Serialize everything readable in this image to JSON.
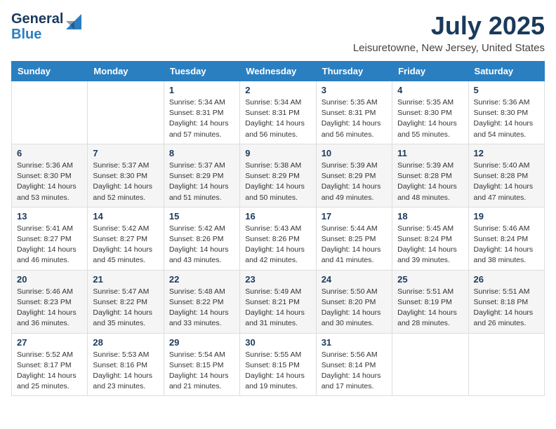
{
  "header": {
    "logo_line1": "General",
    "logo_line2": "Blue",
    "month_year": "July 2025",
    "location": "Leisuretowne, New Jersey, United States"
  },
  "days_of_week": [
    "Sunday",
    "Monday",
    "Tuesday",
    "Wednesday",
    "Thursday",
    "Friday",
    "Saturday"
  ],
  "weeks": [
    [
      {
        "day": "",
        "sunrise": "",
        "sunset": "",
        "daylight": ""
      },
      {
        "day": "",
        "sunrise": "",
        "sunset": "",
        "daylight": ""
      },
      {
        "day": "1",
        "sunrise": "Sunrise: 5:34 AM",
        "sunset": "Sunset: 8:31 PM",
        "daylight": "Daylight: 14 hours and 57 minutes."
      },
      {
        "day": "2",
        "sunrise": "Sunrise: 5:34 AM",
        "sunset": "Sunset: 8:31 PM",
        "daylight": "Daylight: 14 hours and 56 minutes."
      },
      {
        "day": "3",
        "sunrise": "Sunrise: 5:35 AM",
        "sunset": "Sunset: 8:31 PM",
        "daylight": "Daylight: 14 hours and 56 minutes."
      },
      {
        "day": "4",
        "sunrise": "Sunrise: 5:35 AM",
        "sunset": "Sunset: 8:30 PM",
        "daylight": "Daylight: 14 hours and 55 minutes."
      },
      {
        "day": "5",
        "sunrise": "Sunrise: 5:36 AM",
        "sunset": "Sunset: 8:30 PM",
        "daylight": "Daylight: 14 hours and 54 minutes."
      }
    ],
    [
      {
        "day": "6",
        "sunrise": "Sunrise: 5:36 AM",
        "sunset": "Sunset: 8:30 PM",
        "daylight": "Daylight: 14 hours and 53 minutes."
      },
      {
        "day": "7",
        "sunrise": "Sunrise: 5:37 AM",
        "sunset": "Sunset: 8:30 PM",
        "daylight": "Daylight: 14 hours and 52 minutes."
      },
      {
        "day": "8",
        "sunrise": "Sunrise: 5:37 AM",
        "sunset": "Sunset: 8:29 PM",
        "daylight": "Daylight: 14 hours and 51 minutes."
      },
      {
        "day": "9",
        "sunrise": "Sunrise: 5:38 AM",
        "sunset": "Sunset: 8:29 PM",
        "daylight": "Daylight: 14 hours and 50 minutes."
      },
      {
        "day": "10",
        "sunrise": "Sunrise: 5:39 AM",
        "sunset": "Sunset: 8:29 PM",
        "daylight": "Daylight: 14 hours and 49 minutes."
      },
      {
        "day": "11",
        "sunrise": "Sunrise: 5:39 AM",
        "sunset": "Sunset: 8:28 PM",
        "daylight": "Daylight: 14 hours and 48 minutes."
      },
      {
        "day": "12",
        "sunrise": "Sunrise: 5:40 AM",
        "sunset": "Sunset: 8:28 PM",
        "daylight": "Daylight: 14 hours and 47 minutes."
      }
    ],
    [
      {
        "day": "13",
        "sunrise": "Sunrise: 5:41 AM",
        "sunset": "Sunset: 8:27 PM",
        "daylight": "Daylight: 14 hours and 46 minutes."
      },
      {
        "day": "14",
        "sunrise": "Sunrise: 5:42 AM",
        "sunset": "Sunset: 8:27 PM",
        "daylight": "Daylight: 14 hours and 45 minutes."
      },
      {
        "day": "15",
        "sunrise": "Sunrise: 5:42 AM",
        "sunset": "Sunset: 8:26 PM",
        "daylight": "Daylight: 14 hours and 43 minutes."
      },
      {
        "day": "16",
        "sunrise": "Sunrise: 5:43 AM",
        "sunset": "Sunset: 8:26 PM",
        "daylight": "Daylight: 14 hours and 42 minutes."
      },
      {
        "day": "17",
        "sunrise": "Sunrise: 5:44 AM",
        "sunset": "Sunset: 8:25 PM",
        "daylight": "Daylight: 14 hours and 41 minutes."
      },
      {
        "day": "18",
        "sunrise": "Sunrise: 5:45 AM",
        "sunset": "Sunset: 8:24 PM",
        "daylight": "Daylight: 14 hours and 39 minutes."
      },
      {
        "day": "19",
        "sunrise": "Sunrise: 5:46 AM",
        "sunset": "Sunset: 8:24 PM",
        "daylight": "Daylight: 14 hours and 38 minutes."
      }
    ],
    [
      {
        "day": "20",
        "sunrise": "Sunrise: 5:46 AM",
        "sunset": "Sunset: 8:23 PM",
        "daylight": "Daylight: 14 hours and 36 minutes."
      },
      {
        "day": "21",
        "sunrise": "Sunrise: 5:47 AM",
        "sunset": "Sunset: 8:22 PM",
        "daylight": "Daylight: 14 hours and 35 minutes."
      },
      {
        "day": "22",
        "sunrise": "Sunrise: 5:48 AM",
        "sunset": "Sunset: 8:22 PM",
        "daylight": "Daylight: 14 hours and 33 minutes."
      },
      {
        "day": "23",
        "sunrise": "Sunrise: 5:49 AM",
        "sunset": "Sunset: 8:21 PM",
        "daylight": "Daylight: 14 hours and 31 minutes."
      },
      {
        "day": "24",
        "sunrise": "Sunrise: 5:50 AM",
        "sunset": "Sunset: 8:20 PM",
        "daylight": "Daylight: 14 hours and 30 minutes."
      },
      {
        "day": "25",
        "sunrise": "Sunrise: 5:51 AM",
        "sunset": "Sunset: 8:19 PM",
        "daylight": "Daylight: 14 hours and 28 minutes."
      },
      {
        "day": "26",
        "sunrise": "Sunrise: 5:51 AM",
        "sunset": "Sunset: 8:18 PM",
        "daylight": "Daylight: 14 hours and 26 minutes."
      }
    ],
    [
      {
        "day": "27",
        "sunrise": "Sunrise: 5:52 AM",
        "sunset": "Sunset: 8:17 PM",
        "daylight": "Daylight: 14 hours and 25 minutes."
      },
      {
        "day": "28",
        "sunrise": "Sunrise: 5:53 AM",
        "sunset": "Sunset: 8:16 PM",
        "daylight": "Daylight: 14 hours and 23 minutes."
      },
      {
        "day": "29",
        "sunrise": "Sunrise: 5:54 AM",
        "sunset": "Sunset: 8:15 PM",
        "daylight": "Daylight: 14 hours and 21 minutes."
      },
      {
        "day": "30",
        "sunrise": "Sunrise: 5:55 AM",
        "sunset": "Sunset: 8:15 PM",
        "daylight": "Daylight: 14 hours and 19 minutes."
      },
      {
        "day": "31",
        "sunrise": "Sunrise: 5:56 AM",
        "sunset": "Sunset: 8:14 PM",
        "daylight": "Daylight: 14 hours and 17 minutes."
      },
      {
        "day": "",
        "sunrise": "",
        "sunset": "",
        "daylight": ""
      },
      {
        "day": "",
        "sunrise": "",
        "sunset": "",
        "daylight": ""
      }
    ]
  ]
}
